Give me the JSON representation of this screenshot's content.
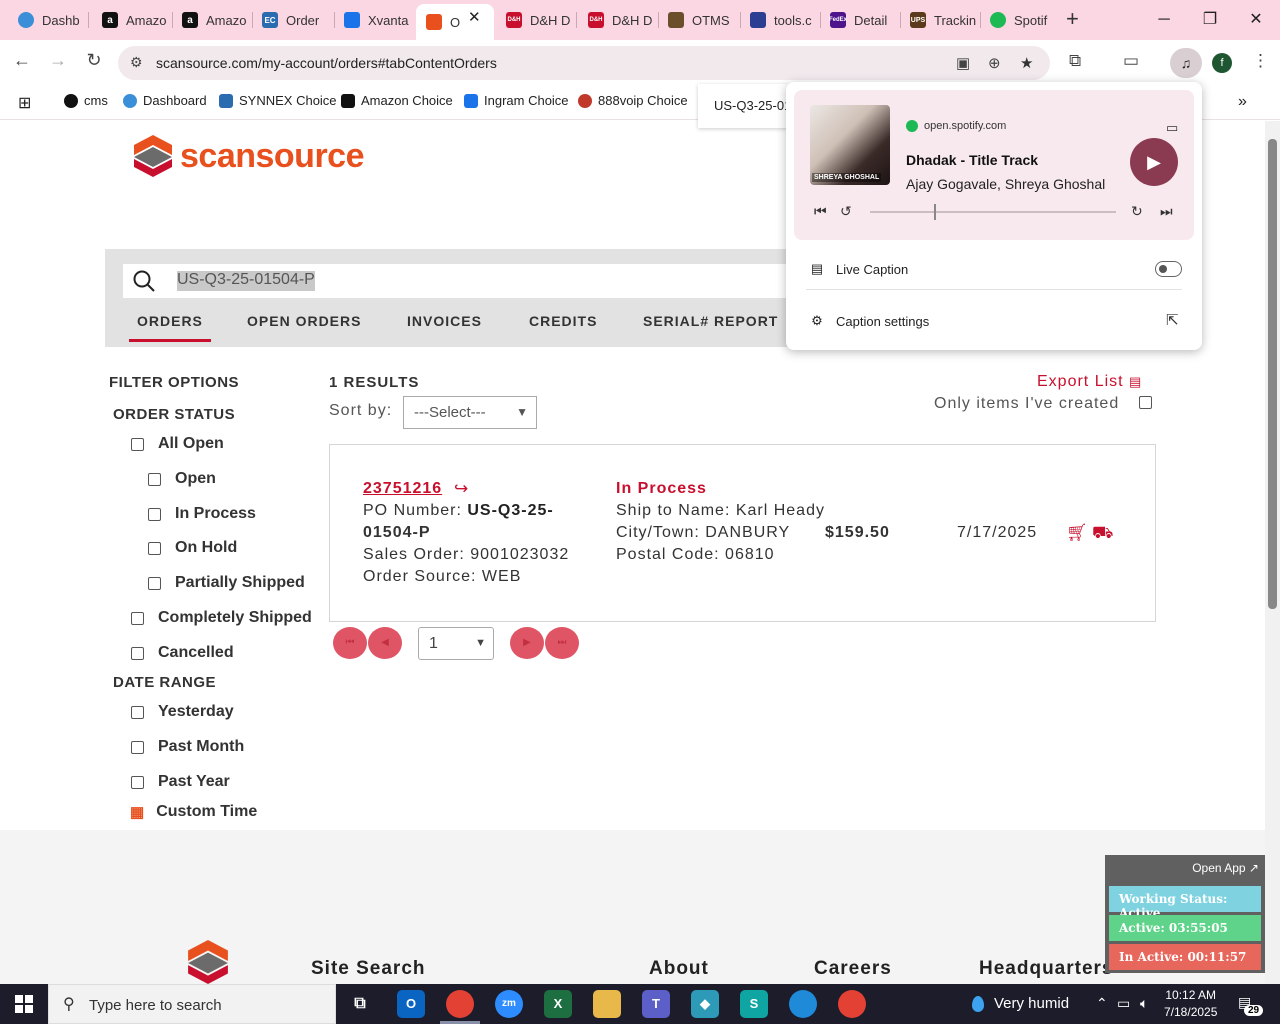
{
  "browser": {
    "tabs": [
      {
        "label": "Dashb",
        "icon": "dashboard-icon",
        "color": "#3b8fd8"
      },
      {
        "label": "Amazo",
        "icon": "amazon-icon",
        "color": "#111111"
      },
      {
        "label": "Amazo",
        "icon": "amazon-icon",
        "color": "#111111"
      },
      {
        "label": "Order",
        "icon": "ec-icon",
        "color": "#2b6cb0"
      },
      {
        "label": "Xvanta",
        "icon": "xvantage-icon",
        "color": "#1a73e8"
      },
      {
        "label": "O",
        "icon": "scansource-icon",
        "color": "#e8501e"
      },
      {
        "label": "D&H D",
        "icon": "dh-icon",
        "color": "#c8102e"
      },
      {
        "label": "D&H D",
        "icon": "dh-icon",
        "color": "#c8102e"
      },
      {
        "label": "OTMS",
        "icon": "otms-icon",
        "color": "#6b4f2a"
      },
      {
        "label": "tools.c",
        "icon": "tools-icon",
        "color": "#2c3e91"
      },
      {
        "label": "Detail",
        "icon": "fedex-icon",
        "color": "#4d148c"
      },
      {
        "label": "Trackin",
        "icon": "ups-icon",
        "color": "#5a3a1a"
      },
      {
        "label": "Spotif",
        "icon": "spotify-icon",
        "color": "#1db954"
      }
    ],
    "url": "scansource.com/my-account/orders#tabContentOrders",
    "profile_initial": "f",
    "bookmarks": [
      {
        "label": "cms",
        "color": "#111111"
      },
      {
        "label": "Dashboard",
        "color": "#3b8fd8"
      },
      {
        "label": "SYNNEX Choice",
        "color": "#2b6cb0"
      },
      {
        "label": "Amazon Choice",
        "color": "#111111"
      },
      {
        "label": "Ingram Choice",
        "color": "#1a73e8"
      },
      {
        "label": "888voip Choice",
        "color": "#c0392b"
      }
    ],
    "url_chip": "US-Q3-25-01"
  },
  "site": {
    "logo_text": "scansource",
    "search_value": "US-Q3-25-01504-P",
    "nav_tabs": [
      "ORDERS",
      "OPEN ORDERS",
      "INVOICES",
      "CREDITS",
      "SERIAL# REPORT"
    ]
  },
  "filters": {
    "title": "FILTER OPTIONS",
    "order_status_title": "ORDER STATUS",
    "order_status": [
      "All Open",
      "Open",
      "In Process",
      "On Hold",
      "Partially Shipped",
      "Completely Shipped",
      "Cancelled"
    ],
    "date_range_title": "DATE RANGE",
    "date_range": [
      "Yesterday",
      "Past Month",
      "Past Year"
    ],
    "custom_time": "Custom Time"
  },
  "results": {
    "count_label": "1 RESULTS",
    "sort_label": "Sort by:",
    "sort_value": "---Select---",
    "export_label": "Export List",
    "only_mine_label": "Only items I've created",
    "order": {
      "number": "23751216",
      "po_label": "PO Number:",
      "po_line1": "US-Q3-25-",
      "po_line2": "01504-P",
      "sales_order": "Sales Order: 9001023032",
      "order_source": "Order Source: WEB",
      "status": "In Process",
      "ship_to": "Ship to Name: Karl Heady",
      "city": "City/Town: DANBURY",
      "postal": "Postal Code: 06810",
      "amount": "$159.50",
      "date": "7/17/2025"
    },
    "page_value": "1"
  },
  "footer": {
    "headings": [
      "Site Search",
      "About",
      "Careers",
      "Headquarters"
    ]
  },
  "media": {
    "source": "open.spotify.com",
    "song": "Dhadak - Title Track",
    "artist": "Ajay Gogavale, Shreya Ghoshal",
    "album_label": "SHREYA GHOSHAL",
    "progress_fraction": 0.26,
    "live_caption": "Live Caption",
    "live_caption_on": false,
    "caption_settings": "Caption settings"
  },
  "work_status": {
    "open_app": "Open App ↗",
    "status": "Working Status: Active",
    "active": "Active: 03:55:05",
    "inactive": "In Active: 00:11:57",
    "colors": {
      "status": "#7fd3e0",
      "active": "#5fd38a",
      "inactive": "#e8675c"
    }
  },
  "taskbar": {
    "search_placeholder": "Type here to search",
    "weather": "Very humid",
    "time": "10:12 AM",
    "date": "7/18/2025",
    "notifications": "29"
  },
  "colors": {
    "brand_orange": "#e8501e",
    "accent_red": "#c8102e",
    "tabstrip": "#fbd7e3"
  }
}
